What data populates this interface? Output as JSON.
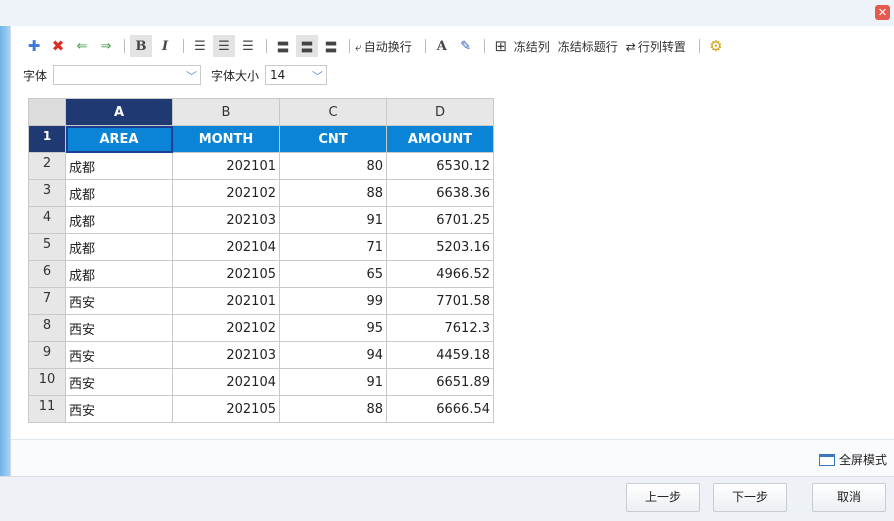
{
  "window": {
    "close_glyph": "✕"
  },
  "toolbar": {
    "icons": [
      "add-icon",
      "delete-icon",
      "arrow-left-icon",
      "arrow-right-icon"
    ],
    "bold": "B",
    "italic": "I",
    "wrap_label": "自动换行",
    "font_color": "A",
    "freeze_col": "冻结列",
    "freeze_title": "冻结标题行",
    "transpose": "行列转置"
  },
  "format": {
    "font_label": "字体",
    "font_value": "",
    "size_label": "字体大小",
    "size_value": "14"
  },
  "sheet": {
    "columns": [
      "A",
      "B",
      "C",
      "D"
    ],
    "header": [
      "AREA",
      "MONTH",
      "CNT",
      "AMOUNT"
    ],
    "rows": [
      {
        "n": "2",
        "area": "成都",
        "month": "202101",
        "cnt": "80",
        "amount": "6530.12"
      },
      {
        "n": "3",
        "area": "成都",
        "month": "202102",
        "cnt": "88",
        "amount": "6638.36"
      },
      {
        "n": "4",
        "area": "成都",
        "month": "202103",
        "cnt": "91",
        "amount": "6701.25"
      },
      {
        "n": "5",
        "area": "成都",
        "month": "202104",
        "cnt": "71",
        "amount": "5203.16"
      },
      {
        "n": "6",
        "area": "成都",
        "month": "202105",
        "cnt": "65",
        "amount": "4966.52"
      },
      {
        "n": "7",
        "area": "西安",
        "month": "202101",
        "cnt": "99",
        "amount": "7701.58"
      },
      {
        "n": "8",
        "area": "西安",
        "month": "202102",
        "cnt": "95",
        "amount": "7612.3"
      },
      {
        "n": "9",
        "area": "西安",
        "month": "202103",
        "cnt": "94",
        "amount": "4459.18"
      },
      {
        "n": "10",
        "area": "西安",
        "month": "202104",
        "cnt": "91",
        "amount": "6651.89"
      },
      {
        "n": "11",
        "area": "西安",
        "month": "202105",
        "cnt": "88",
        "amount": "6666.54"
      }
    ],
    "header_row_num": "1"
  },
  "status": {
    "fullscreen": "全屏模式"
  },
  "buttons": {
    "prev": "上一步",
    "next": "下一步",
    "cancel": "取消"
  },
  "colors": {
    "header_bg": "#0a84d6",
    "selected_header": "#1f3a73",
    "accent": "#5e8fd6"
  }
}
